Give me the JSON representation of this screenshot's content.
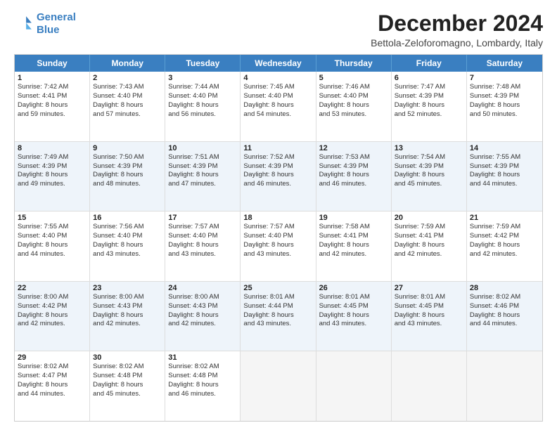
{
  "logo": {
    "line1": "General",
    "line2": "Blue"
  },
  "title": "December 2024",
  "location": "Bettola-Zeloforomagno, Lombardy, Italy",
  "headers": [
    "Sunday",
    "Monday",
    "Tuesday",
    "Wednesday",
    "Thursday",
    "Friday",
    "Saturday"
  ],
  "rows": [
    {
      "alt": false,
      "cells": [
        {
          "day": "1",
          "lines": [
            "Sunrise: 7:42 AM",
            "Sunset: 4:41 PM",
            "Daylight: 8 hours",
            "and 59 minutes."
          ]
        },
        {
          "day": "2",
          "lines": [
            "Sunrise: 7:43 AM",
            "Sunset: 4:40 PM",
            "Daylight: 8 hours",
            "and 57 minutes."
          ]
        },
        {
          "day": "3",
          "lines": [
            "Sunrise: 7:44 AM",
            "Sunset: 4:40 PM",
            "Daylight: 8 hours",
            "and 56 minutes."
          ]
        },
        {
          "day": "4",
          "lines": [
            "Sunrise: 7:45 AM",
            "Sunset: 4:40 PM",
            "Daylight: 8 hours",
            "and 54 minutes."
          ]
        },
        {
          "day": "5",
          "lines": [
            "Sunrise: 7:46 AM",
            "Sunset: 4:40 PM",
            "Daylight: 8 hours",
            "and 53 minutes."
          ]
        },
        {
          "day": "6",
          "lines": [
            "Sunrise: 7:47 AM",
            "Sunset: 4:39 PM",
            "Daylight: 8 hours",
            "and 52 minutes."
          ]
        },
        {
          "day": "7",
          "lines": [
            "Sunrise: 7:48 AM",
            "Sunset: 4:39 PM",
            "Daylight: 8 hours",
            "and 50 minutes."
          ]
        }
      ]
    },
    {
      "alt": true,
      "cells": [
        {
          "day": "8",
          "lines": [
            "Sunrise: 7:49 AM",
            "Sunset: 4:39 PM",
            "Daylight: 8 hours",
            "and 49 minutes."
          ]
        },
        {
          "day": "9",
          "lines": [
            "Sunrise: 7:50 AM",
            "Sunset: 4:39 PM",
            "Daylight: 8 hours",
            "and 48 minutes."
          ]
        },
        {
          "day": "10",
          "lines": [
            "Sunrise: 7:51 AM",
            "Sunset: 4:39 PM",
            "Daylight: 8 hours",
            "and 47 minutes."
          ]
        },
        {
          "day": "11",
          "lines": [
            "Sunrise: 7:52 AM",
            "Sunset: 4:39 PM",
            "Daylight: 8 hours",
            "and 46 minutes."
          ]
        },
        {
          "day": "12",
          "lines": [
            "Sunrise: 7:53 AM",
            "Sunset: 4:39 PM",
            "Daylight: 8 hours",
            "and 46 minutes."
          ]
        },
        {
          "day": "13",
          "lines": [
            "Sunrise: 7:54 AM",
            "Sunset: 4:39 PM",
            "Daylight: 8 hours",
            "and 45 minutes."
          ]
        },
        {
          "day": "14",
          "lines": [
            "Sunrise: 7:55 AM",
            "Sunset: 4:39 PM",
            "Daylight: 8 hours",
            "and 44 minutes."
          ]
        }
      ]
    },
    {
      "alt": false,
      "cells": [
        {
          "day": "15",
          "lines": [
            "Sunrise: 7:55 AM",
            "Sunset: 4:40 PM",
            "Daylight: 8 hours",
            "and 44 minutes."
          ]
        },
        {
          "day": "16",
          "lines": [
            "Sunrise: 7:56 AM",
            "Sunset: 4:40 PM",
            "Daylight: 8 hours",
            "and 43 minutes."
          ]
        },
        {
          "day": "17",
          "lines": [
            "Sunrise: 7:57 AM",
            "Sunset: 4:40 PM",
            "Daylight: 8 hours",
            "and 43 minutes."
          ]
        },
        {
          "day": "18",
          "lines": [
            "Sunrise: 7:57 AM",
            "Sunset: 4:40 PM",
            "Daylight: 8 hours",
            "and 43 minutes."
          ]
        },
        {
          "day": "19",
          "lines": [
            "Sunrise: 7:58 AM",
            "Sunset: 4:41 PM",
            "Daylight: 8 hours",
            "and 42 minutes."
          ]
        },
        {
          "day": "20",
          "lines": [
            "Sunrise: 7:59 AM",
            "Sunset: 4:41 PM",
            "Daylight: 8 hours",
            "and 42 minutes."
          ]
        },
        {
          "day": "21",
          "lines": [
            "Sunrise: 7:59 AM",
            "Sunset: 4:42 PM",
            "Daylight: 8 hours",
            "and 42 minutes."
          ]
        }
      ]
    },
    {
      "alt": true,
      "cells": [
        {
          "day": "22",
          "lines": [
            "Sunrise: 8:00 AM",
            "Sunset: 4:42 PM",
            "Daylight: 8 hours",
            "and 42 minutes."
          ]
        },
        {
          "day": "23",
          "lines": [
            "Sunrise: 8:00 AM",
            "Sunset: 4:43 PM",
            "Daylight: 8 hours",
            "and 42 minutes."
          ]
        },
        {
          "day": "24",
          "lines": [
            "Sunrise: 8:00 AM",
            "Sunset: 4:43 PM",
            "Daylight: 8 hours",
            "and 42 minutes."
          ]
        },
        {
          "day": "25",
          "lines": [
            "Sunrise: 8:01 AM",
            "Sunset: 4:44 PM",
            "Daylight: 8 hours",
            "and 43 minutes."
          ]
        },
        {
          "day": "26",
          "lines": [
            "Sunrise: 8:01 AM",
            "Sunset: 4:45 PM",
            "Daylight: 8 hours",
            "and 43 minutes."
          ]
        },
        {
          "day": "27",
          "lines": [
            "Sunrise: 8:01 AM",
            "Sunset: 4:45 PM",
            "Daylight: 8 hours",
            "and 43 minutes."
          ]
        },
        {
          "day": "28",
          "lines": [
            "Sunrise: 8:02 AM",
            "Sunset: 4:46 PM",
            "Daylight: 8 hours",
            "and 44 minutes."
          ]
        }
      ]
    },
    {
      "alt": false,
      "cells": [
        {
          "day": "29",
          "lines": [
            "Sunrise: 8:02 AM",
            "Sunset: 4:47 PM",
            "Daylight: 8 hours",
            "and 44 minutes."
          ]
        },
        {
          "day": "30",
          "lines": [
            "Sunrise: 8:02 AM",
            "Sunset: 4:48 PM",
            "Daylight: 8 hours",
            "and 45 minutes."
          ]
        },
        {
          "day": "31",
          "lines": [
            "Sunrise: 8:02 AM",
            "Sunset: 4:48 PM",
            "Daylight: 8 hours",
            "and 46 minutes."
          ]
        },
        null,
        null,
        null,
        null
      ]
    }
  ]
}
